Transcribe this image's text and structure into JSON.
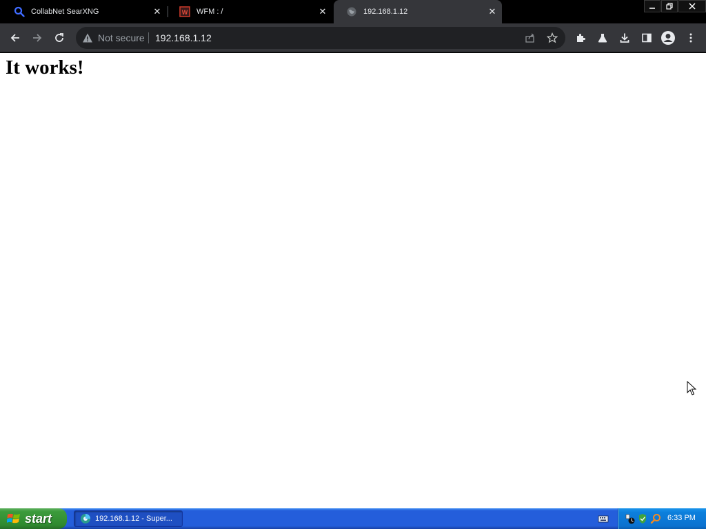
{
  "browser": {
    "tabs": [
      {
        "title": "CollabNet SearXNG",
        "icon": "search-icon",
        "active": false
      },
      {
        "title": "WFM : /",
        "icon": "wfm-icon",
        "active": false
      },
      {
        "title": "192.168.1.12",
        "icon": "globe-icon",
        "active": true
      }
    ],
    "window_controls": [
      "minimize",
      "restore",
      "close"
    ],
    "address_bar": {
      "security_label": "Not secure",
      "url": "192.168.1.12"
    },
    "toolbar_icons": [
      "share-icon",
      "bookmark-star-icon",
      "extensions-icon",
      "labs-icon",
      "download-icon",
      "side-panel-icon",
      "profile-icon",
      "menu-icon"
    ]
  },
  "page": {
    "heading": "It works!"
  },
  "taskbar": {
    "start_label": "start",
    "items": [
      {
        "label": "192.168.1.12 - Super...",
        "icon": "browser-icon"
      }
    ],
    "clock": "6:33 PM"
  },
  "colors": {
    "tabstrip": "#000000",
    "toolbar": "#35363a",
    "omnibox": "#202124",
    "taskbar": "#245edb",
    "start_button": "#3c9b3c",
    "tray": "#0c7fdc"
  }
}
